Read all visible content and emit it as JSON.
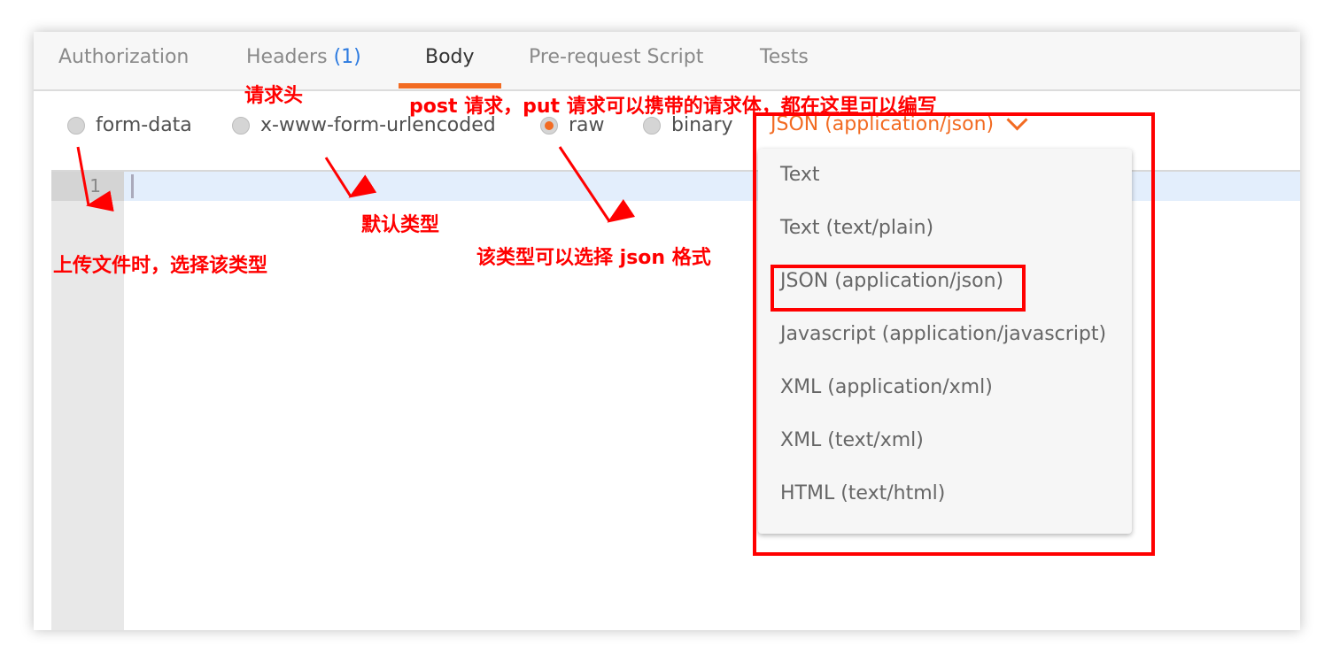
{
  "tabs": [
    {
      "label": "Authorization"
    },
    {
      "label": "Headers",
      "count": "(1)"
    },
    {
      "label": "Body",
      "active": true
    },
    {
      "label": "Pre-request Script"
    },
    {
      "label": "Tests"
    }
  ],
  "body_types": [
    {
      "label": "form-data",
      "selected": false
    },
    {
      "label": "x-www-form-urlencoded",
      "selected": false
    },
    {
      "label": "raw",
      "selected": true
    },
    {
      "label": "binary",
      "selected": false
    }
  ],
  "format_select": {
    "value": "JSON (application/json)",
    "icon": "chevron-down-icon"
  },
  "menu_items": [
    "Text",
    "Text (text/plain)",
    "JSON (application/json)",
    "Javascript (application/javascript)",
    "XML (application/xml)",
    "XML (text/xml)",
    "HTML (text/html)"
  ],
  "editor": {
    "line_number": "1"
  },
  "annotations": {
    "headers": "请求头",
    "body": "post 请求，put 请求可以携带的请求体，都在这里可以编写",
    "urlencoded": "默认类型",
    "form_data": "上传文件时，选择该类型",
    "raw": "该类型可以选择 json 格式"
  },
  "colors": {
    "accent": "#f26b22",
    "annotation": "#ff0000",
    "count": "#2d7be0"
  }
}
